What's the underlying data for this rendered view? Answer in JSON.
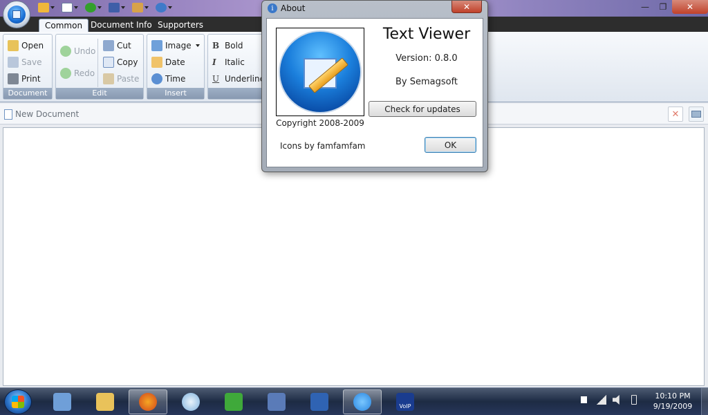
{
  "window": {
    "close_symbol": "✕",
    "minimize_symbol": "—",
    "maximize_symbol": "❐",
    "quick_access": [
      {
        "icon": "pencil-icon",
        "color": "#f0b73b"
      },
      {
        "icon": "new-window-icon",
        "color": "#ffffff"
      },
      {
        "icon": "add-icon",
        "color": "#33a02c"
      },
      {
        "icon": "flag-icon",
        "color": "#3f5ea8"
      },
      {
        "icon": "tools-icon",
        "color": "#d7a24a"
      },
      {
        "icon": "help-icon",
        "color": "#3f7ac9"
      }
    ]
  },
  "ribbon": {
    "tabs": [
      "Common",
      "Document Info",
      "Supporters"
    ],
    "groups": {
      "document": {
        "name": "Document",
        "open": "Open",
        "save": "Save",
        "print": "Print"
      },
      "edit": {
        "name": "Edit",
        "undo": "Undo",
        "redo": "Redo",
        "cut": "Cut",
        "copy": "Copy",
        "paste": "Paste"
      },
      "insert": {
        "name": "Insert",
        "image": "Image",
        "date": "Date",
        "time": "Time"
      },
      "format": {
        "bold": "Bold",
        "italic": "Italic",
        "underline": "Underline",
        "bold_glyph": "B",
        "italic_glyph": "I",
        "underline_glyph": "U"
      }
    }
  },
  "document_tab": {
    "label": "New Document",
    "close_symbol": "✕"
  },
  "about_dialog": {
    "title": "About",
    "info_glyph": "i",
    "close_symbol": "✕",
    "app_name": "Text Viewer",
    "version": "Version: 0.8.0",
    "author": "By Semagsoft",
    "check_updates_label": "Check for updates",
    "copyright": "Copyright 2008-2009",
    "icons_by": "Icons by famfamfam",
    "ok_label": "OK"
  },
  "taskbar": {
    "apps": [
      {
        "icon": "control-panel-icon",
        "color": "#6f9fd8"
      },
      {
        "icon": "folder-icon",
        "color": "#e9c25a"
      },
      {
        "icon": "firefox-icon",
        "color": "#e66b1f"
      },
      {
        "icon": "media-player-icon",
        "color": "#7fb2de"
      },
      {
        "icon": "utorrent-icon",
        "color": "#3fa93a"
      },
      {
        "icon": "graphics-editor-icon",
        "color": "#5a7bb8"
      },
      {
        "icon": "vb-icon",
        "color": "#2f63b3"
      },
      {
        "icon": "text-viewer-icon",
        "color": "#2a86e0"
      },
      {
        "icon": "voip-icon",
        "color": "#1a3c8f"
      }
    ],
    "voip_label": "VoIP",
    "time": "10:10 PM",
    "date": "9/19/2009"
  },
  "colors": {
    "ribbon_group_header": "#8899b1",
    "dialog_ok_border": "#3c7fb1",
    "close_red": "#c0412a"
  }
}
